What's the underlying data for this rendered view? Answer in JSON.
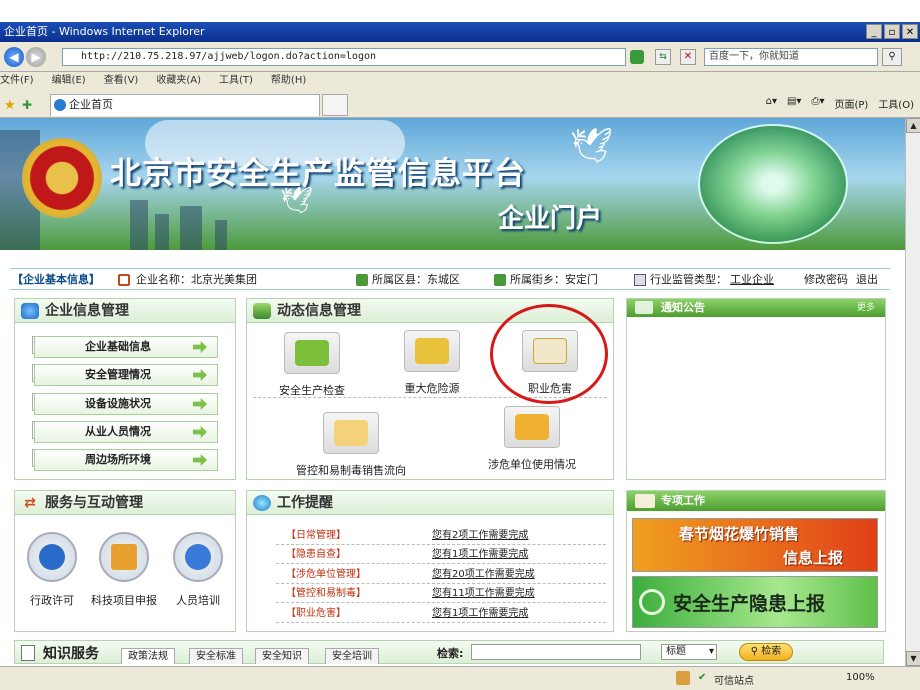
{
  "window": {
    "title": "企业首页 - Windows Internet Explorer"
  },
  "addressbar": {
    "url": "http://210.75.218.97/ajjweb/logon.do?action=logon",
    "search_placeholder": "百度一下，你就知道"
  },
  "menu": [
    "文件(F)",
    "编辑(E)",
    "查看(V)",
    "收藏夹(A)",
    "工具(T)",
    "帮助(H)"
  ],
  "tab": {
    "label": "企业首页"
  },
  "toolbar": {
    "page": "页面(P)",
    "tools": "工具(O)"
  },
  "banner": {
    "title": "北京市安全生产监管信息平台",
    "subtitle": "企业门户"
  },
  "info": {
    "tag": "【企业基本信息】",
    "company": "企业名称：北京光美集团",
    "district": "所属区县：东城区",
    "street": "所属街乡：安定门",
    "type_label": "行业监管类型：",
    "type_value": "工业企业",
    "change_pwd": "修改密码",
    "logout": "退出"
  },
  "left_panel": {
    "title": "企业信息管理",
    "items": [
      "企业基础信息",
      "安全管理情况",
      "设备设施状况",
      "从业人员情况",
      "周边场所环境"
    ]
  },
  "dynamic_panel": {
    "title": "动态信息管理",
    "items": [
      "安全生产检查",
      "重大危险源",
      "职业危害",
      "管控和易制毒销售流向",
      "涉危单位使用情况"
    ]
  },
  "notice_panel": {
    "title": "通知公告",
    "more": "更多"
  },
  "service_panel": {
    "title": "服务与互动管理",
    "items": [
      "行政许可",
      "科技项目申报",
      "人员培训"
    ]
  },
  "work_panel": {
    "title": "工作提醒",
    "rows": [
      {
        "cat": "【日常管理】",
        "msg": "您有2项工作需要完成"
      },
      {
        "cat": "【隐患自查】",
        "msg": "您有1项工作需要完成"
      },
      {
        "cat": "【涉危单位管理】",
        "msg": "您有20项工作需要完成"
      },
      {
        "cat": "【管控和易制毒】",
        "msg": "您有11项工作需要完成"
      },
      {
        "cat": "【职业危害】",
        "msg": "您有1项工作需要完成"
      }
    ]
  },
  "special_panel": {
    "title": "专项工作",
    "banner1_line1": "春节烟花爆竹销售",
    "banner1_line2": "信息上报",
    "banner2": "安全生产隐患上报"
  },
  "knowledge": {
    "title": "知识服务",
    "tabs": [
      "政策法规",
      "安全标准",
      "安全知识",
      "安全培训"
    ],
    "search_label": "检索:",
    "select_value": "标题",
    "search_button": "检索"
  },
  "status": {
    "trusted": "可信站点",
    "zoom": "100%"
  },
  "colors": {
    "titlebar": "#0a2f8c",
    "panel_green": "#4c9d2e",
    "circle": "#d81818"
  }
}
